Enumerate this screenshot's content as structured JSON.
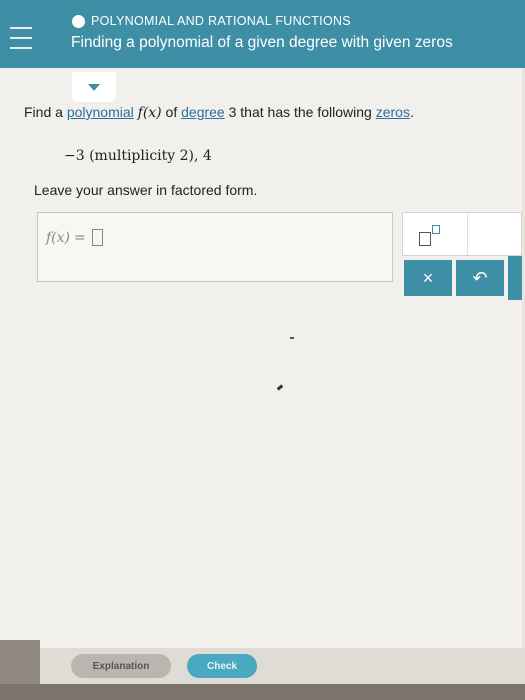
{
  "header": {
    "topic": "POLYNOMIAL AND RATIONAL FUNCTIONS",
    "title": "Finding a polynomial of a given degree with given zeros"
  },
  "icons": {
    "menu": "hamburger-menu-icon",
    "status": "circle-icon",
    "collapse": "triangle-down-icon",
    "exponent": "exponent-template-icon",
    "clear": "times-icon",
    "undo": "undo-arrow-icon"
  },
  "question": {
    "pre": "Find a ",
    "polynomial_link": "polynomial",
    "func": "f(x)",
    "mid": " of ",
    "degree_link": "degree",
    "degree_value": "3",
    "post": " that has the following ",
    "zeros_link": "zeros",
    "end": "."
  },
  "zeros_text": "−3 (multiplicity 2), 4",
  "instruction": "Leave your answer in factored form.",
  "answer": {
    "lhs": "f(x)",
    "eq": "="
  },
  "keypad": {
    "clear_label": "×",
    "undo_label": "↶"
  },
  "footer": {
    "explanation_label": "Explanation",
    "check_label": "Check"
  },
  "colors": {
    "header": "#3e8fa6",
    "link": "#2b6f9c",
    "check_button": "#4aa9c0"
  }
}
